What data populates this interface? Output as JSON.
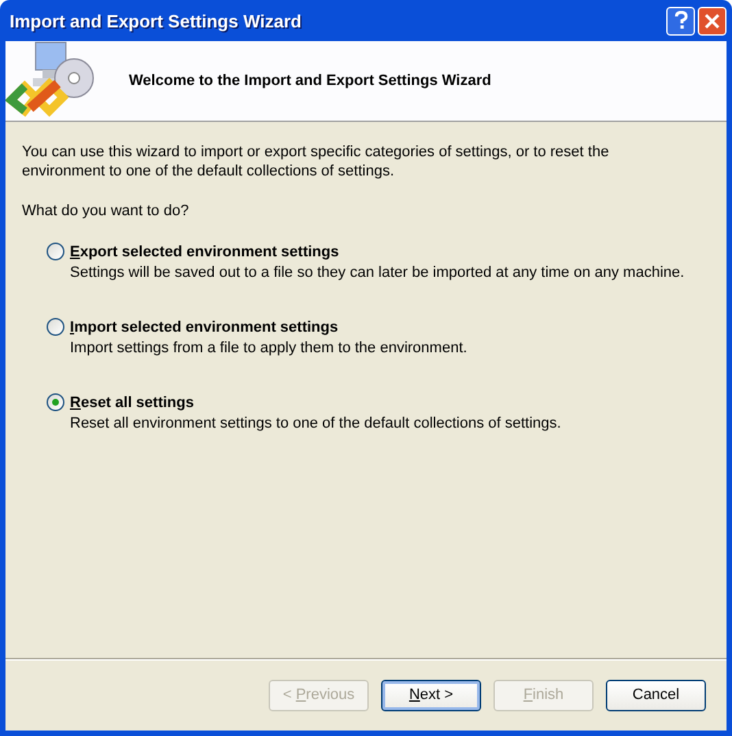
{
  "window": {
    "title": "Import and Export Settings Wizard"
  },
  "header": {
    "title": "Welcome to the Import and Export Settings Wizard"
  },
  "intro": "You can use this wizard to import or export specific categories of settings, or to reset the environment to one of the default collections of settings.",
  "question": "What do you want to do?",
  "options": [
    {
      "label_key": "E",
      "label_after": "xport selected environment settings",
      "description": "Settings will be saved out to a file so they can later be imported at any time on any machine.",
      "selected": false
    },
    {
      "label_key": "I",
      "label_after": "mport selected environment settings",
      "description": "Import settings from a file to apply them to the environment.",
      "selected": false
    },
    {
      "label_key": "R",
      "label_after": "eset all settings",
      "description": "Reset all environment settings to one of the default collections of settings.",
      "selected": true
    }
  ],
  "buttons": [
    {
      "label_before": "< ",
      "label_key": "P",
      "label_after": "revious",
      "disabled": true,
      "default": false
    },
    {
      "label_key": "N",
      "label_after": "ext >",
      "disabled": false,
      "default": true
    },
    {
      "label_key": "F",
      "label_after": "inish",
      "disabled": true,
      "default": false
    },
    {
      "label_before": "Cancel",
      "disabled": false,
      "default": false
    }
  ]
}
